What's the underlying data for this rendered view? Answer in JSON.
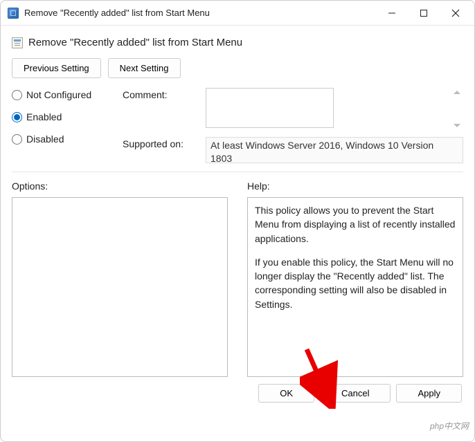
{
  "window": {
    "title": "Remove \"Recently added\" list from Start Menu"
  },
  "header": {
    "title": "Remove \"Recently added\" list from Start Menu"
  },
  "nav": {
    "prev_label": "Previous Setting",
    "next_label": "Next Setting"
  },
  "state_radios": {
    "not_configured": "Not Configured",
    "enabled": "Enabled",
    "disabled": "Disabled",
    "selected": "enabled"
  },
  "fields": {
    "comment_label": "Comment:",
    "comment_value": "",
    "supported_label": "Supported on:",
    "supported_value": "At least Windows Server 2016, Windows 10 Version 1803"
  },
  "options": {
    "label": "Options:",
    "value": ""
  },
  "help": {
    "label": "Help:",
    "p1": "This policy allows you to prevent the Start Menu from displaying a list of recently installed applications.",
    "p2": "If you enable this policy, the Start Menu will no longer display the \"Recently added\" list. The corresponding setting will also be disabled in Settings."
  },
  "footer": {
    "ok": "OK",
    "cancel": "Cancel",
    "apply": "Apply"
  },
  "watermark": "php中文网"
}
